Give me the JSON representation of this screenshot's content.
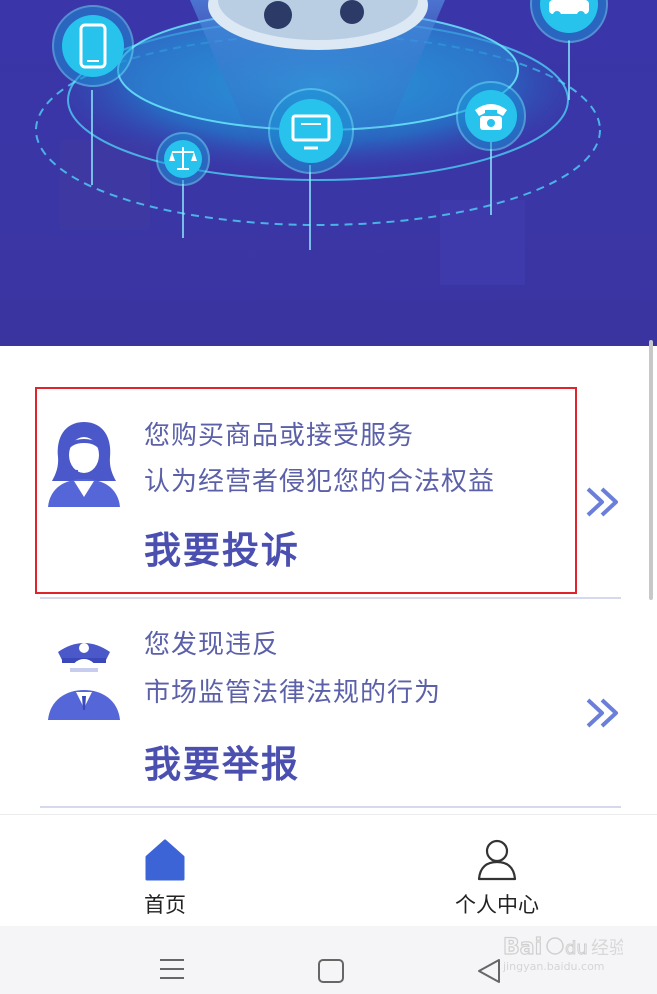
{
  "complaint": {
    "line1": "您购买商品或接受服务",
    "line2": "认为经营者侵犯您的合法权益",
    "title": "我要投诉"
  },
  "report": {
    "line1": "您发现违反",
    "line2": "市场监管法律法规的行为",
    "title": "我要举报"
  },
  "tabbar": {
    "home_label": "首页",
    "profile_label": "个人中心"
  },
  "colors": {
    "banner": "#3a35a8",
    "accent": "#4a4fb0",
    "home_tab": "#3d64d6",
    "highlight": "#e0242b"
  },
  "icons": [
    "phone-icon",
    "scales-icon",
    "monitor-icon",
    "telephone-icon",
    "car-icon",
    "headset-agent-icon",
    "police-officer-icon",
    "double-chevron-right-icon",
    "home-icon",
    "person-icon",
    "menu-icon",
    "square-icon",
    "back-triangle-icon"
  ]
}
